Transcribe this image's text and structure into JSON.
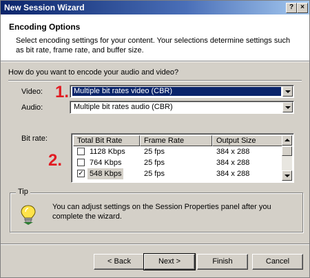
{
  "window": {
    "title": "New Session Wizard",
    "help_glyph": "?",
    "close_glyph": "×"
  },
  "header": {
    "title": "Encoding Options",
    "description": "Select encoding settings for your content. Your selections determine settings such as bit rate, frame rate, and buffer size."
  },
  "question": "How do you want to encode your audio and video?",
  "video": {
    "label": "Video:",
    "value": "Multiple bit rates video (CBR)"
  },
  "audio": {
    "label": "Audio:",
    "value": "Multiple bit rates audio (CBR)"
  },
  "annotations": {
    "first": "1.",
    "second": "2."
  },
  "bitrate": {
    "label": "Bit rate:",
    "columns": [
      "Total Bit Rate",
      "Frame Rate",
      "Output Size"
    ],
    "rows": [
      {
        "checked": false,
        "rate": "1128 Kbps",
        "fps": "25 fps",
        "size": "384 x 288"
      },
      {
        "checked": false,
        "rate": "764 Kbps",
        "fps": "25 fps",
        "size": "384 x 288"
      },
      {
        "checked": true,
        "rate": "548 Kbps",
        "fps": "25 fps",
        "size": "384 x 288"
      }
    ],
    "check_glyph": "✓"
  },
  "tip": {
    "legend": "Tip",
    "text": "You can adjust settings on the Session Properties panel after you complete the wizard."
  },
  "buttons": {
    "back": "< Back",
    "next": "Next >",
    "finish": "Finish",
    "cancel": "Cancel"
  },
  "colors": {
    "title_bar": "#0a246a",
    "annotation": "#e11b22",
    "selection": "#0a246a",
    "dialog": "#d4d0c8"
  }
}
